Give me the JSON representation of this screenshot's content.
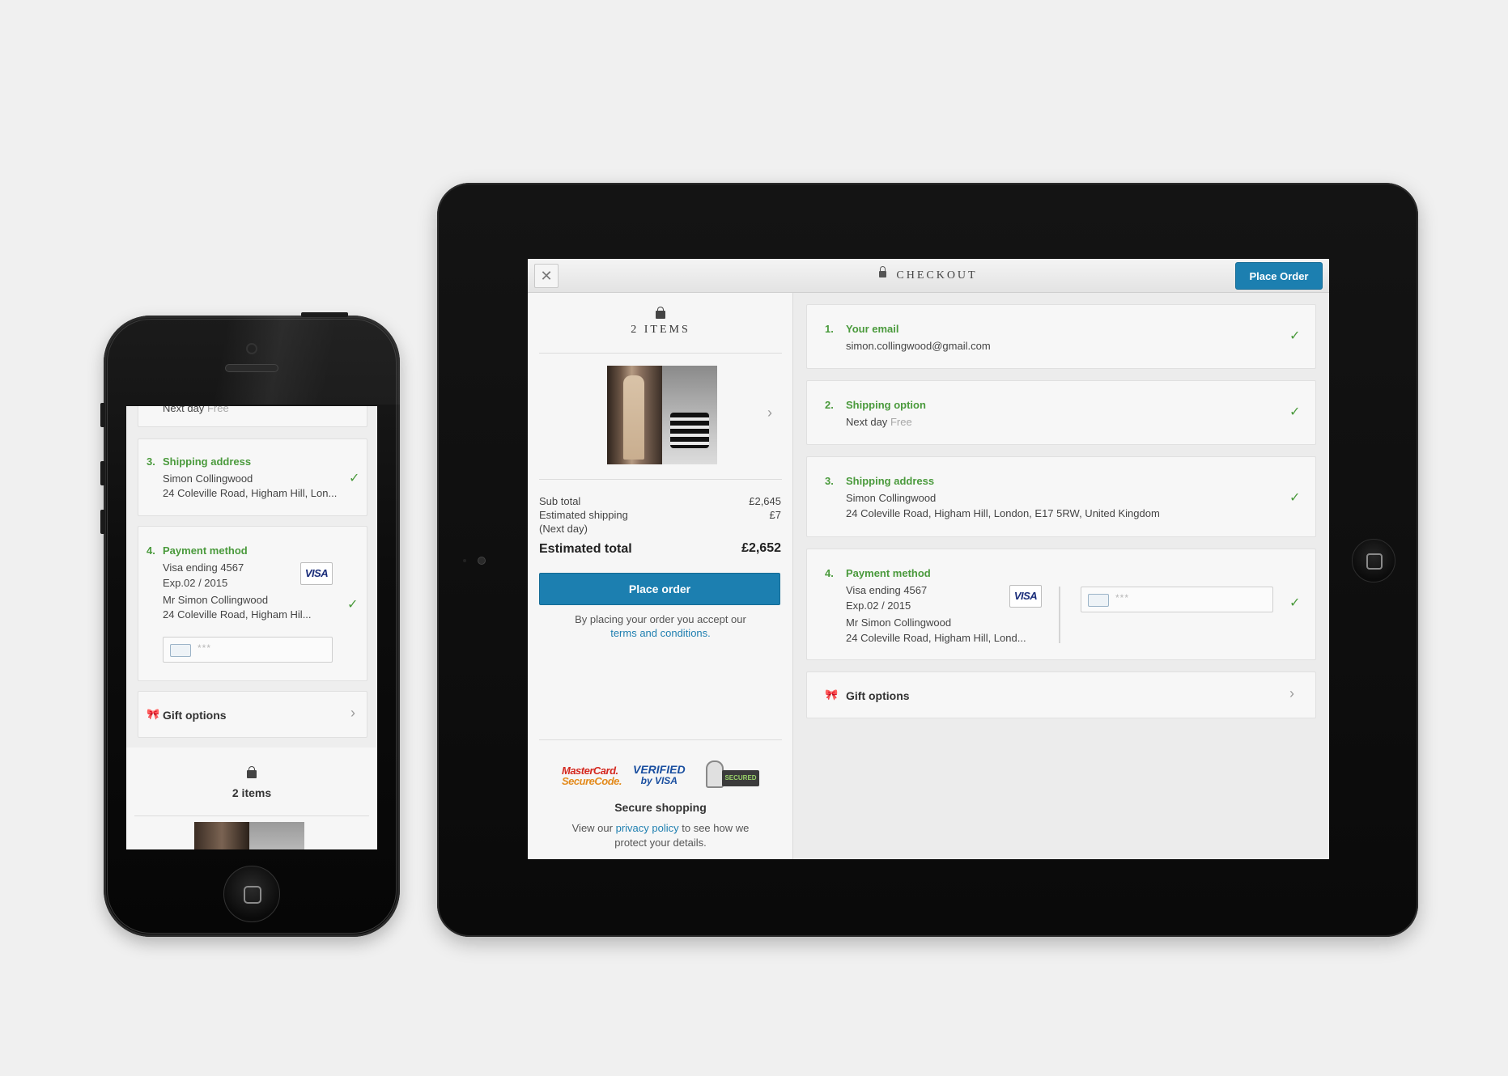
{
  "checkout": {
    "title": "CHECKOUT",
    "place_order_top": "Place Order",
    "items_header": "2 ITEMS",
    "subtotal_label": "Sub total",
    "subtotal_value": "£2,645",
    "shipping_label": "Estimated shipping",
    "shipping_value": "£7",
    "shipping_note": "(Next day)",
    "total_label": "Estimated total",
    "total_value": "£2,652",
    "place_order_button": "Place order",
    "terms_text": "By placing your order you accept our",
    "terms_link": "terms and conditions.",
    "badges": {
      "mastercard_top": "MasterCard.",
      "mastercard_bottom": "SecureCode.",
      "verified": "VERIFIED",
      "by_visa": "by VISA",
      "comodo": "SECURED"
    },
    "secure_title": "Secure shopping",
    "privacy_prefix": "View our",
    "privacy_link": "privacy policy",
    "privacy_suffix": "to see how we",
    "privacy_suffix2": "protect your details."
  },
  "steps": {
    "email": {
      "num": "1.",
      "title": "Your email",
      "value": "simon.collingwood@gmail.com"
    },
    "shipping_option": {
      "num": "2.",
      "title": "Shipping option",
      "value": "Next day",
      "price": "Free"
    },
    "shipping_address": {
      "num": "3.",
      "title": "Shipping address",
      "name": "Simon Collingwood",
      "address": "24 Coleville Road, Higham Hill, London, E17 5RW, United Kingdom",
      "address_short": "24 Coleville Road, Higham Hill, Lon..."
    },
    "payment": {
      "num": "4.",
      "title": "Payment method",
      "card": "Visa ending 4567",
      "expiry": "Exp.02 / 2015",
      "holder": "Mr Simon Collingwood",
      "billing": "24 Coleville Road, Higham Hill, Lond...",
      "billing_short": "24 Coleville Road, Higham Hil...",
      "card_brand": "VISA",
      "cvv_mask": "***"
    },
    "gift": {
      "title": "Gift options"
    }
  },
  "phone": {
    "partial_top": "Next day",
    "partial_free": "Free",
    "items_label": "2 items"
  },
  "colors": {
    "accent": "#1c7fb0",
    "green": "#4a9a3c"
  },
  "icons": [
    "lock-icon",
    "close-icon",
    "bag-icon",
    "check-icon",
    "chevron-right-icon",
    "gift-icon",
    "card-icon"
  ]
}
